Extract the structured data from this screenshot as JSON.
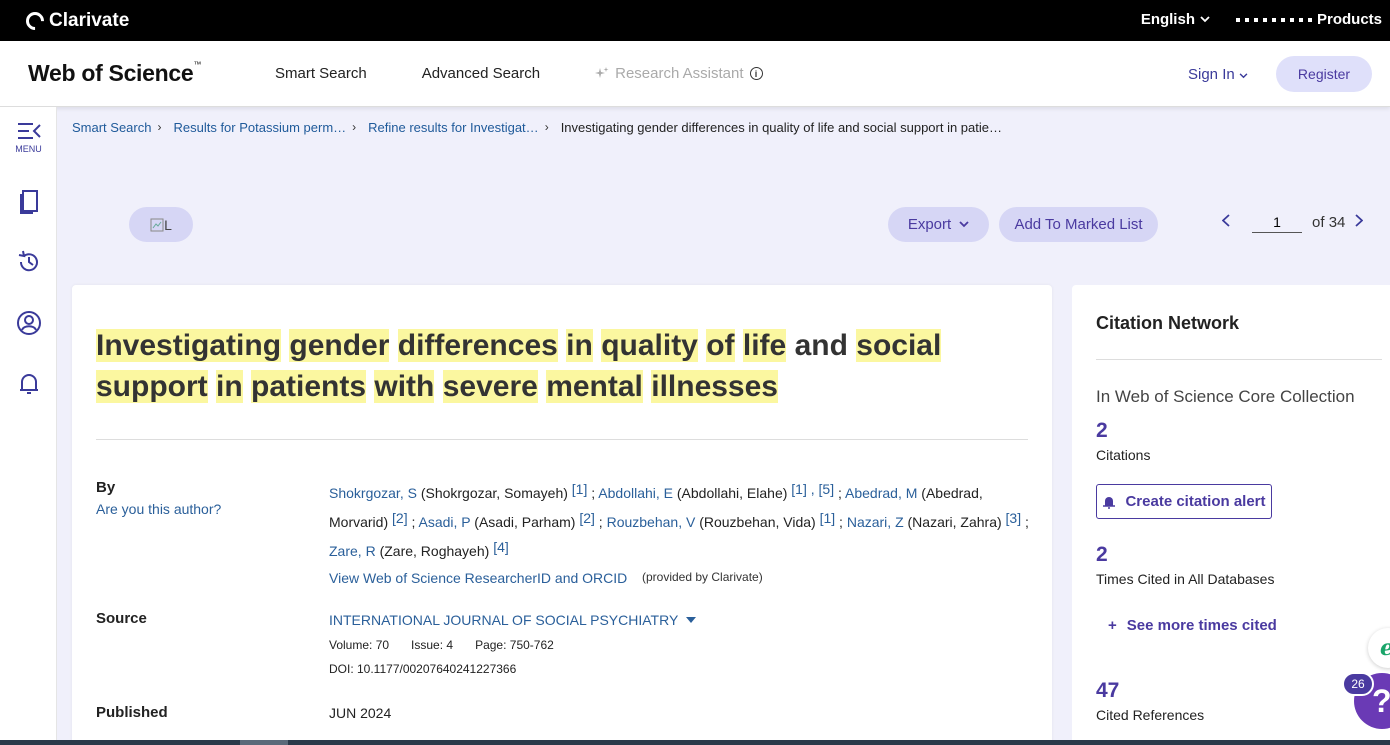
{
  "topbar": {
    "brand": "Clarivate",
    "language": "English",
    "products": "Products"
  },
  "header": {
    "logo": "Web of Science",
    "logo_tm": "™",
    "nav": [
      "Smart Search",
      "Advanced Search"
    ],
    "research_assistant": "Research Assistant",
    "sign_in": "Sign In",
    "register": "Register"
  },
  "rail": {
    "menu_label": "MENU",
    "icons": [
      "menu-icon",
      "bookmark-icon",
      "history-icon",
      "profile-icon",
      "bell-icon"
    ]
  },
  "breadcrumb": {
    "items": [
      "Smart Search",
      "Results for Potassium perm…",
      "Refine results for Investigat…",
      "Investigating gender differences in quality of life and social support in patie…"
    ]
  },
  "toolbar": {
    "l_button": "L",
    "export": "Export",
    "add_to_marked_list": "Add To Marked List",
    "page_current": "1",
    "page_of": "of",
    "page_total": "34"
  },
  "record": {
    "title_words": [
      {
        "w": "Investigating",
        "hl": true
      },
      {
        "w": "gender",
        "hl": true
      },
      {
        "w": "differences",
        "hl": true
      },
      {
        "w": "in",
        "hl": true
      },
      {
        "w": "quality",
        "hl": true
      },
      {
        "w": "of",
        "hl": true
      },
      {
        "w": "life",
        "hl": true
      },
      {
        "w": "and",
        "hl": false
      },
      {
        "w": "social",
        "hl": true
      },
      {
        "w": "support",
        "hl": true
      },
      {
        "w": "in",
        "hl": true
      },
      {
        "w": "patients",
        "hl": true
      },
      {
        "w": "with",
        "hl": true
      },
      {
        "w": "severe",
        "hl": true
      },
      {
        "w": "mental",
        "hl": true
      },
      {
        "w": "illnesses",
        "hl": true
      }
    ],
    "by_label": "By",
    "are_you_author": "Are you this author?",
    "authors": [
      {
        "short": "Shokrgozar, S",
        "full": "Shokrgozar, Somayeh",
        "aff": "[1]"
      },
      {
        "short": "Abdollahi, E",
        "full": "Abdollahi, Elahe",
        "aff": "[1] , [5]"
      },
      {
        "short": "Abedrad, M",
        "full": "Abedrad, Morvarid",
        "aff": "[2]"
      },
      {
        "short": "Asadi, P",
        "full": "Asadi, Parham",
        "aff": "[2]"
      },
      {
        "short": "Rouzbehan, V",
        "full": "Rouzbehan, Vida",
        "aff": "[1]"
      },
      {
        "short": "Nazari, Z",
        "full": "Nazari, Zahra",
        "aff": "[3]"
      },
      {
        "short": "Zare, R",
        "full": "Zare, Roghayeh",
        "aff": "[4]"
      }
    ],
    "researcher_link": "View Web of Science ResearcherID and ORCID",
    "provided_by": "(provided by Clarivate)",
    "source_label": "Source",
    "journal": "INTERNATIONAL JOURNAL OF SOCIAL PSYCHIATRY",
    "volume": "Volume: 70",
    "issue": "Issue: 4",
    "page": "Page: 750-762",
    "doi": "DOI: 10.1177/00207640241227366",
    "published_label": "Published",
    "published": "JUN 2024"
  },
  "citation_network": {
    "title": "Citation Network",
    "subtitle": "In Web of Science Core Collection",
    "citations_count": "2",
    "citations_label": "Citations",
    "create_alert": "Create citation alert",
    "times_cited_count": "2",
    "times_cited_label": "Times Cited in All Databases",
    "see_more": "See more times cited",
    "cited_refs_count": "47",
    "cited_refs_label": "Cited References"
  },
  "widgets": {
    "badge": "26",
    "chat_glyph": "?"
  },
  "colors": {
    "accent": "#4a3aa0",
    "link": "#2a5f9a",
    "highlight": "#fbf7a0",
    "page_bg": "#f0f0fb"
  }
}
